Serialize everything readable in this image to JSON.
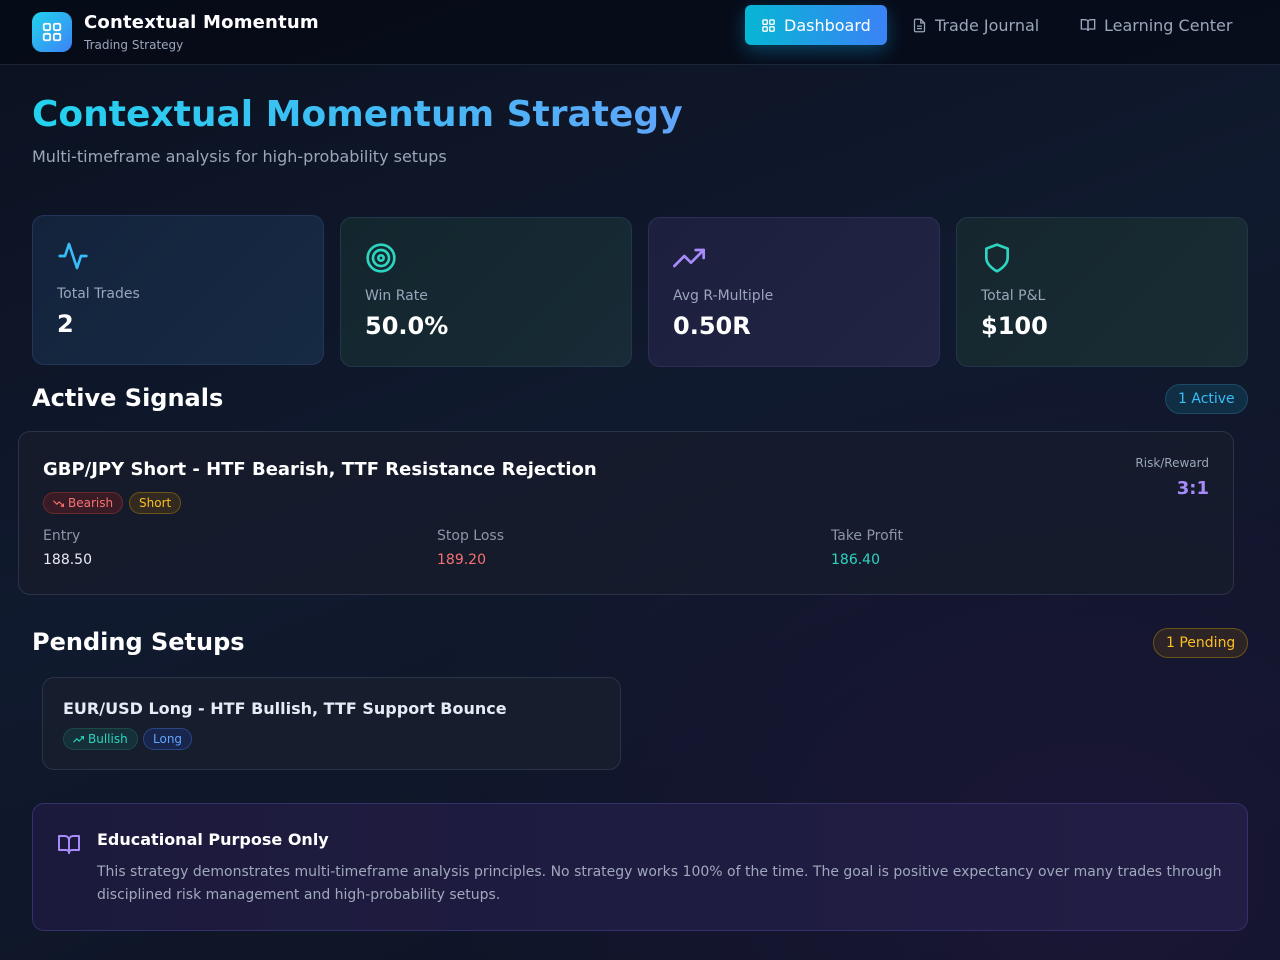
{
  "header": {
    "brand_title": "Contextual Momentum",
    "brand_subtitle": "Trading Strategy",
    "nav": [
      {
        "label": "Dashboard",
        "icon": "grid-icon",
        "active": true
      },
      {
        "label": "Trade Journal",
        "icon": "document-icon",
        "active": false
      },
      {
        "label": "Learning Center",
        "icon": "book-icon",
        "active": false
      }
    ]
  },
  "hero": {
    "title": "Contextual Momentum Strategy",
    "subtitle": "Multi-timeframe analysis for high-probability setups"
  },
  "stats": [
    {
      "label": "Total Trades",
      "value": "2",
      "icon": "activity-icon",
      "color": "#38bdf8"
    },
    {
      "label": "Win Rate",
      "value": "50.0%",
      "icon": "target-icon",
      "color": "#2dd4bf"
    },
    {
      "label": "Avg R-Multiple",
      "value": "0.50R",
      "icon": "trending-up-icon",
      "color": "#a78bfa"
    },
    {
      "label": "Total P&L",
      "value": "$100",
      "icon": "shield-icon",
      "color": "#2dd4bf"
    }
  ],
  "active_signals": {
    "title": "Active Signals",
    "count_label": "1 Active",
    "signal": {
      "title": "GBP/JPY Short - HTF Bearish, TTF Resistance Rejection",
      "bias_tag": "Bearish",
      "direction_tag": "Short",
      "rr_label": "Risk/Reward",
      "rr_value": "3:1",
      "entry_label": "Entry",
      "entry_value": "188.50",
      "stop_label": "Stop Loss",
      "stop_value": "189.20",
      "tp_label": "Take Profit",
      "tp_value": "186.40"
    }
  },
  "pending": {
    "title": "Pending Setups",
    "count_label": "1 Pending",
    "setup": {
      "title": "EUR/USD Long - HTF Bullish, TTF Support Bounce",
      "bias_tag": "Bullish",
      "direction_tag": "Long"
    }
  },
  "education": {
    "title": "Educational Purpose Only",
    "text": "This strategy demonstrates multi-timeframe analysis principles. No strategy works 100% of the time. The goal is positive expectancy over many trades through disciplined risk management and high-probability setups."
  },
  "colors": {
    "accent_cyan": "#22d3ee",
    "accent_blue": "#3b82f6",
    "stop_red": "#f87171",
    "tp_teal": "#2dd4bf",
    "rr_violet": "#a78bfa"
  }
}
